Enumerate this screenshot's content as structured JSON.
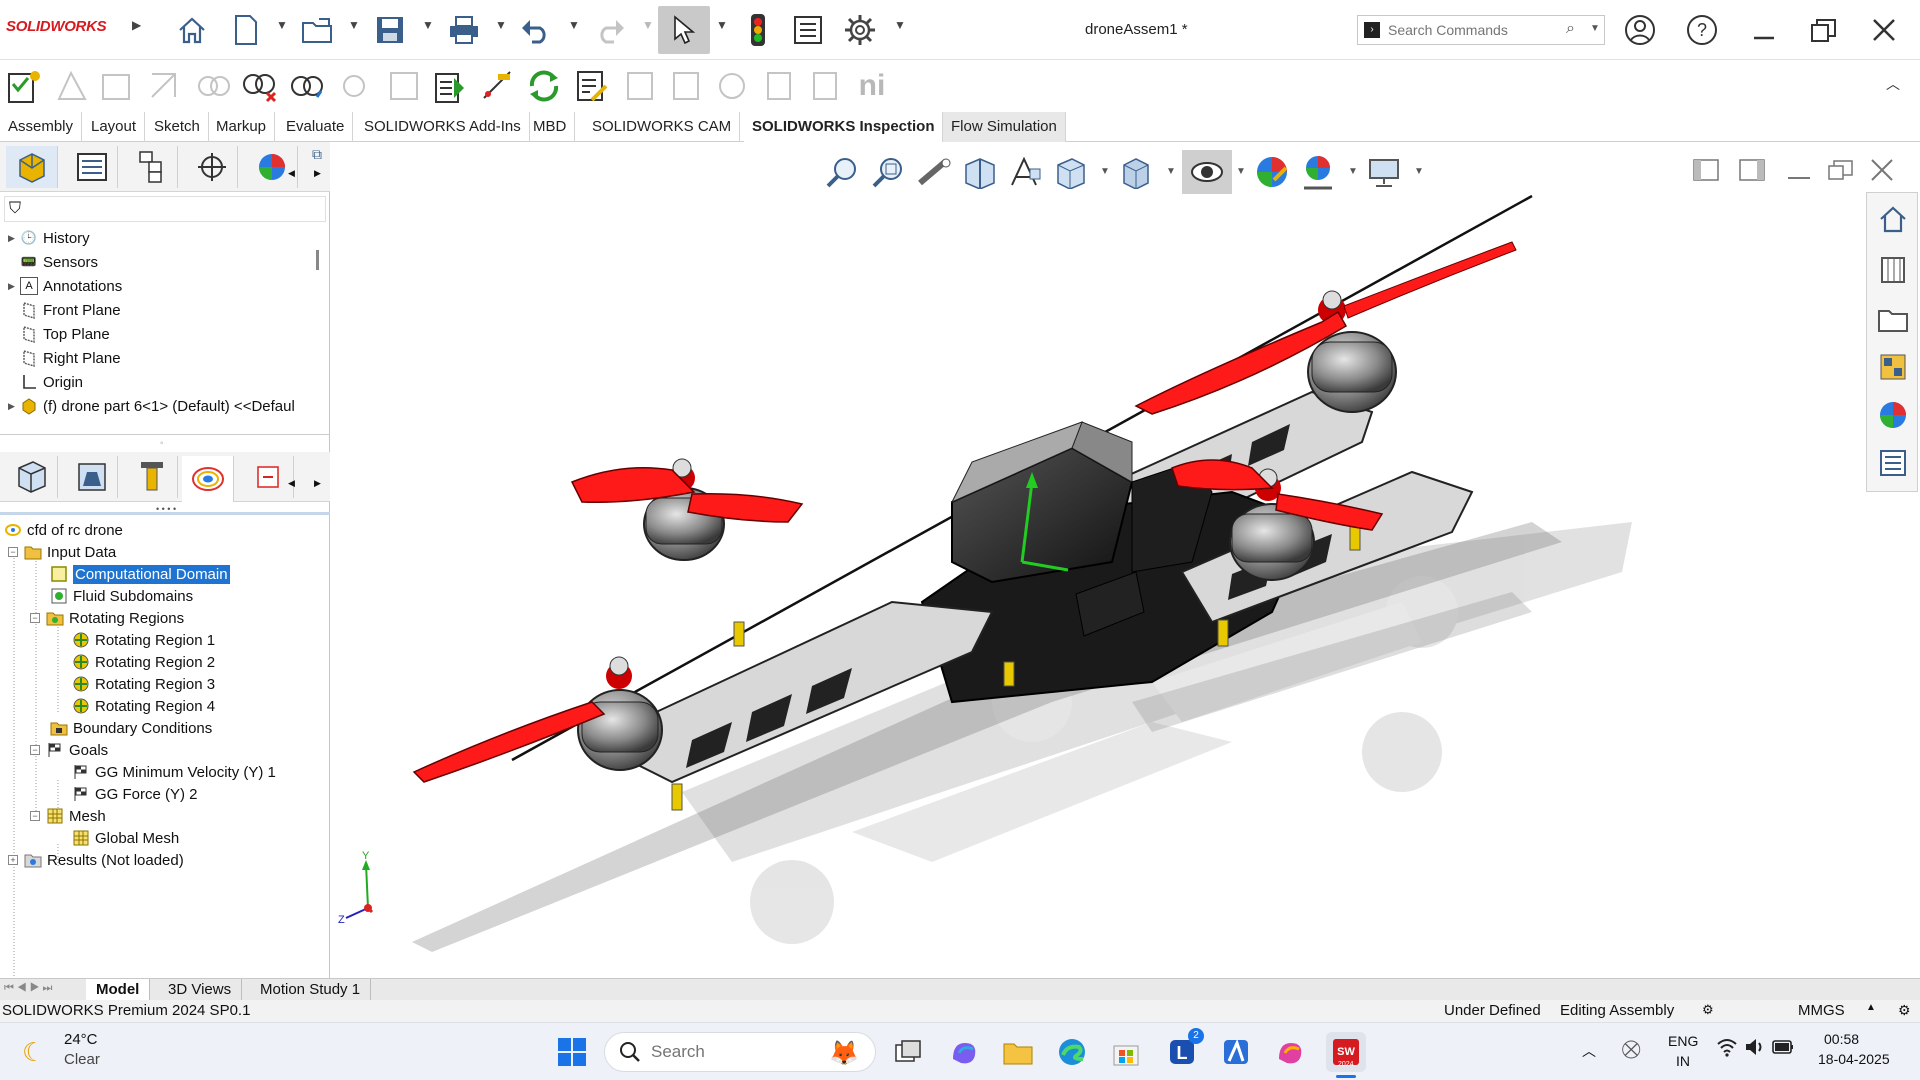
{
  "app": {
    "brand": "SOLIDWORKS",
    "document_title": "droneAssem1 *",
    "search_placeholder": "Search Commands"
  },
  "ribbon_tabs": [
    {
      "label": "Assembly"
    },
    {
      "label": "Layout"
    },
    {
      "label": "Sketch"
    },
    {
      "label": "Markup"
    },
    {
      "label": "Evaluate"
    },
    {
      "label": "SOLIDWORKS Add-Ins"
    },
    {
      "label": "MBD"
    },
    {
      "label": "SOLIDWORKS CAM"
    },
    {
      "label": "SOLIDWORKS Inspection"
    },
    {
      "label": "Flow Simulation"
    }
  ],
  "feature_tree": {
    "items": [
      {
        "label": "History"
      },
      {
        "label": "Sensors"
      },
      {
        "label": "Annotations"
      },
      {
        "label": "Front Plane"
      },
      {
        "label": "Top Plane"
      },
      {
        "label": "Right Plane"
      },
      {
        "label": "Origin"
      },
      {
        "label": "(f) drone part 6<1> (Default) <<Defaul"
      }
    ]
  },
  "flow_tree": {
    "root": "cfd of rc drone",
    "items": [
      {
        "label": "Input Data"
      },
      {
        "label": "Computational Domain"
      },
      {
        "label": "Fluid Subdomains"
      },
      {
        "label": "Rotating Regions"
      },
      {
        "label": "Rotating Region 1"
      },
      {
        "label": "Rotating Region 2"
      },
      {
        "label": "Rotating Region 3"
      },
      {
        "label": "Rotating Region 4"
      },
      {
        "label": "Boundary Conditions"
      },
      {
        "label": "Goals"
      },
      {
        "label": "GG Minimum Velocity (Y) 1"
      },
      {
        "label": "GG Force (Y) 2"
      },
      {
        "label": "Mesh"
      },
      {
        "label": "Global Mesh"
      },
      {
        "label": "Results (Not loaded)"
      }
    ]
  },
  "triad": {
    "y": "Y",
    "z": "Z"
  },
  "model_tabs": [
    {
      "label": "Model"
    },
    {
      "label": "3D Views"
    },
    {
      "label": "Motion Study 1"
    }
  ],
  "status_bar": {
    "product": "SOLIDWORKS Premium 2024 SP0.1",
    "definition": "Under Defined",
    "mode": "Editing Assembly",
    "units": "MMGS"
  },
  "taskbar": {
    "weather_temp": "24°C",
    "weather_desc": "Clear",
    "search_label": "Search",
    "notification_badge": "2",
    "lang_top": "ENG",
    "lang_bottom": "IN",
    "time": "00:58",
    "date": "18-04-2025",
    "sw_year": "2024"
  },
  "colors": {
    "accent": "#1e74d0",
    "propeller": "#ff1a1a",
    "brand_red": "#d51b20"
  }
}
